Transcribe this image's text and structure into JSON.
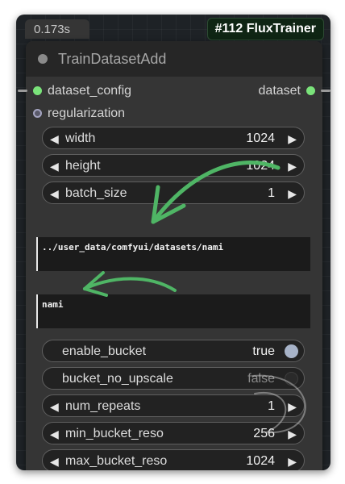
{
  "node": {
    "timing": "0.173s",
    "badge": "#112 FluxTrainer",
    "title": "TrainDatasetAdd"
  },
  "inputs": [
    {
      "label": "dataset_config",
      "connected": true
    },
    {
      "label": "regularization",
      "connected": false
    }
  ],
  "outputs": [
    {
      "label": "dataset"
    }
  ],
  "widgets": {
    "width": {
      "label": "width",
      "value": "1024"
    },
    "height": {
      "label": "height",
      "value": "1024"
    },
    "batch_size": {
      "label": "batch_size",
      "value": "1"
    },
    "image_dir": {
      "value": "../user_data/comfyui/datasets/nami"
    },
    "class_tokens": {
      "value": "nami"
    },
    "enable_bucket": {
      "label": "enable_bucket",
      "value": "true"
    },
    "bucket_no_upscale": {
      "label": "bucket_no_upscale",
      "value": "false"
    },
    "num_repeats": {
      "label": "num_repeats",
      "value": "1"
    },
    "min_bucket_reso": {
      "label": "min_bucket_reso",
      "value": "256"
    },
    "max_bucket_reso": {
      "label": "max_bucket_reso",
      "value": "1024"
    }
  },
  "colors": {
    "connected_port": "#7ae37a",
    "annotation_arrow": "#4fb565",
    "badge_bg": "#0f2514"
  }
}
